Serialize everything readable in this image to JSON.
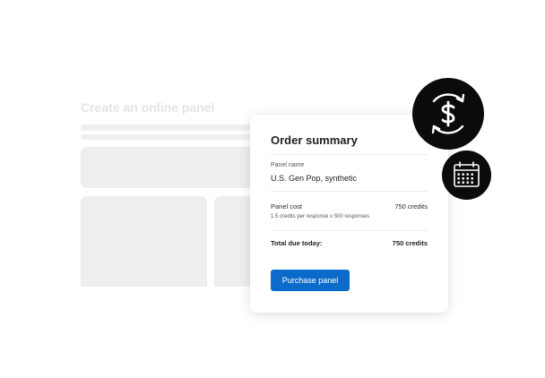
{
  "background": {
    "title": "Create an online panel"
  },
  "order_summary": {
    "title": "Order summary",
    "panel_name_label": "Panel name",
    "panel_name_value": "U.S. Gen Pop, synthetic",
    "panel_cost_label": "Panel cost",
    "panel_cost_value": "750 credits",
    "panel_cost_detail": "1.5 credits per response x 500 responses",
    "total_label": "Total due today:",
    "total_value": "750 credits",
    "purchase_button_label": "Purchase panel"
  },
  "icons": {
    "money_badge": "dollar-refresh-icon",
    "calendar_badge": "calendar-icon"
  },
  "colors": {
    "primary_button": "#0b6bcb",
    "badge_background": "#0b0b0b",
    "background_placeholder": "#eeeeee"
  }
}
